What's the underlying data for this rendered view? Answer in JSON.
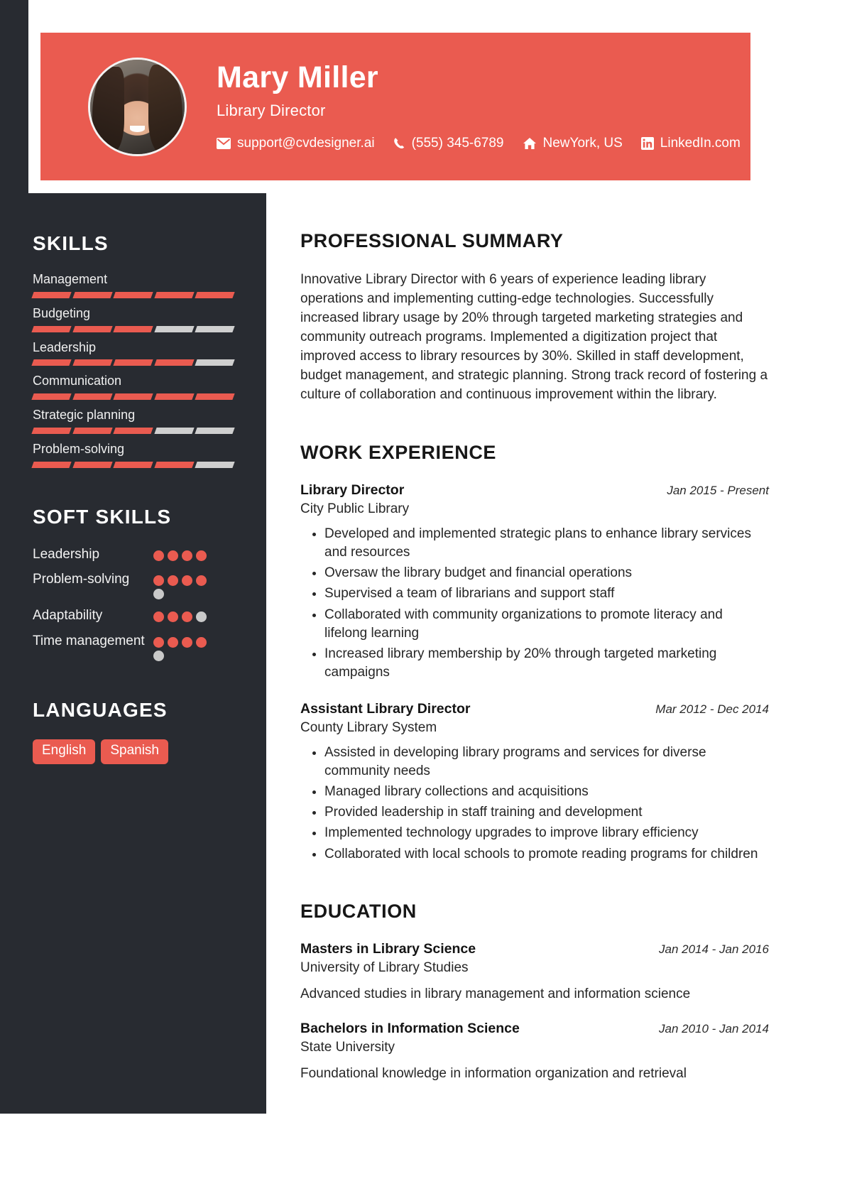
{
  "colors": {
    "accent": "#ea5b50",
    "sidebar_bg": "#282b31",
    "bar_off": "#cfcfcf",
    "dot_off": "#c9c9c9"
  },
  "header": {
    "name": "Mary Miller",
    "role": "Library Director",
    "contacts": [
      {
        "icon": "envelope-icon",
        "text": "support@cvdesigner.ai"
      },
      {
        "icon": "phone-icon",
        "text": "(555) 345-6789"
      },
      {
        "icon": "home-icon",
        "text": "NewYork, US"
      },
      {
        "icon": "linkedin-icon",
        "text": "LinkedIn.com"
      }
    ]
  },
  "sidebar": {
    "skills_heading": "SKILLS",
    "skills": [
      {
        "name": "Management",
        "level": 5,
        "total": 5
      },
      {
        "name": "Budgeting",
        "level": 3,
        "total": 5
      },
      {
        "name": "Leadership",
        "level": 4,
        "total": 5
      },
      {
        "name": "Communication",
        "level": 5,
        "total": 5
      },
      {
        "name": "Strategic planning",
        "level": 3,
        "total": 5
      },
      {
        "name": "Problem-solving",
        "level": 4,
        "total": 5
      }
    ],
    "soft_skills_heading": "SOFT SKILLS",
    "soft_skills": [
      {
        "name": "Leadership",
        "level": 4,
        "total": 4
      },
      {
        "name": "Problem-solving",
        "level": 4,
        "total": 5
      },
      {
        "name": "Adaptability",
        "level": 3,
        "total": 4
      },
      {
        "name": "Time management",
        "level": 4,
        "total": 5
      }
    ],
    "languages_heading": "LANGUAGES",
    "languages": [
      "English",
      "Spanish"
    ]
  },
  "main": {
    "summary_heading": "PROFESSIONAL SUMMARY",
    "summary": "Innovative Library Director with 6 years of experience leading library operations and implementing cutting-edge technologies. Successfully increased library usage by 20% through targeted marketing strategies and community outreach programs. Implemented a digitization project that improved access to library resources by 30%. Skilled in staff development, budget management, and strategic planning. Strong track record of fostering a culture of collaboration and continuous improvement within the library.",
    "experience_heading": "WORK EXPERIENCE",
    "experience": [
      {
        "title": "Library Director",
        "date": "Jan 2015 - Present",
        "org": "City Public Library",
        "bullets": [
          "Developed and implemented strategic plans to enhance library services and resources",
          "Oversaw the library budget and financial operations",
          "Supervised a team of librarians and support staff",
          "Collaborated with community organizations to promote literacy and lifelong learning",
          "Increased library membership by 20% through targeted marketing campaigns"
        ]
      },
      {
        "title": "Assistant Library Director",
        "date": "Mar 2012 - Dec 2014",
        "org": "County Library System",
        "bullets": [
          "Assisted in developing library programs and services for diverse community needs",
          "Managed library collections and acquisitions",
          "Provided leadership in staff training and development",
          "Implemented technology upgrades to improve library efficiency",
          "Collaborated with local schools to promote reading programs for children"
        ]
      }
    ],
    "education_heading": "EDUCATION",
    "education": [
      {
        "degree": "Masters in Library Science",
        "date": "Jan 2014 - Jan 2016",
        "school": "University of Library Studies",
        "desc": "Advanced studies in library management and information science"
      },
      {
        "degree": "Bachelors in Information Science",
        "date": "Jan 2010 - Jan 2014",
        "school": "State University",
        "desc": "Foundational knowledge in information organization and retrieval"
      }
    ]
  }
}
